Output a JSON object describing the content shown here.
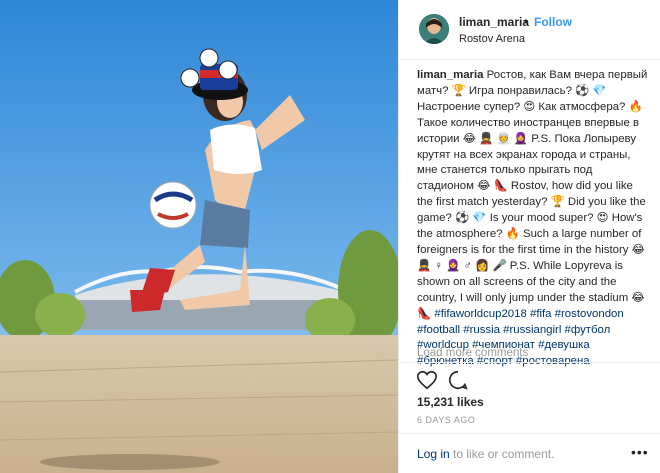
{
  "post": {
    "username": "liman_maria",
    "separator": "•",
    "follow_label": "Follow",
    "location": "Rostov Arena"
  },
  "caption": {
    "author": "liman_maria",
    "text": "Ростов, как Вам вчера первый матч? 🏆 Игра понравилась? ⚽ 💎 Настроение супер? 😍 Как атмосфера? 🔥 Такое количество иностранцев впервые в истории 😂 💂 👳 🧕 P.S. Пока Лопыреву крутят на всех экранах города и страны, мне станется только прыгать под стадионом 😂 👠 Rostov, how did you like the first match yesterday? 🏆 Did you like the game? ⚽ 💎 Is your mood super? 😍 How's the atmosphere? 🔥 Such a large number of foreigners is for the first time in the history 😂 💂 ♀ 🧕 ♂ 👩 🎤 P.S. While Lopyreva is shown on all screens of the city and the country, I will only jump under the stadium 😂 👠",
    "hashtags": "#fifaworldcup2018 #fifa #rostovondon #football #russia #russiangirl #футбол #worldcup #чемпионат #девушка #брюнетка #спорт #ростоварена"
  },
  "load_more": "Load more comments",
  "likes": "15,231 likes",
  "timestamp": "6 DAYS AGO",
  "footer": {
    "login_label": "Log in",
    "prompt": " to like or comment.",
    "more_label": "•••"
  },
  "icons": {
    "heart": "heart-icon",
    "comment": "comment-icon"
  },
  "colors": {
    "link": "#003569",
    "follow": "#3897f0",
    "muted": "#999999"
  }
}
